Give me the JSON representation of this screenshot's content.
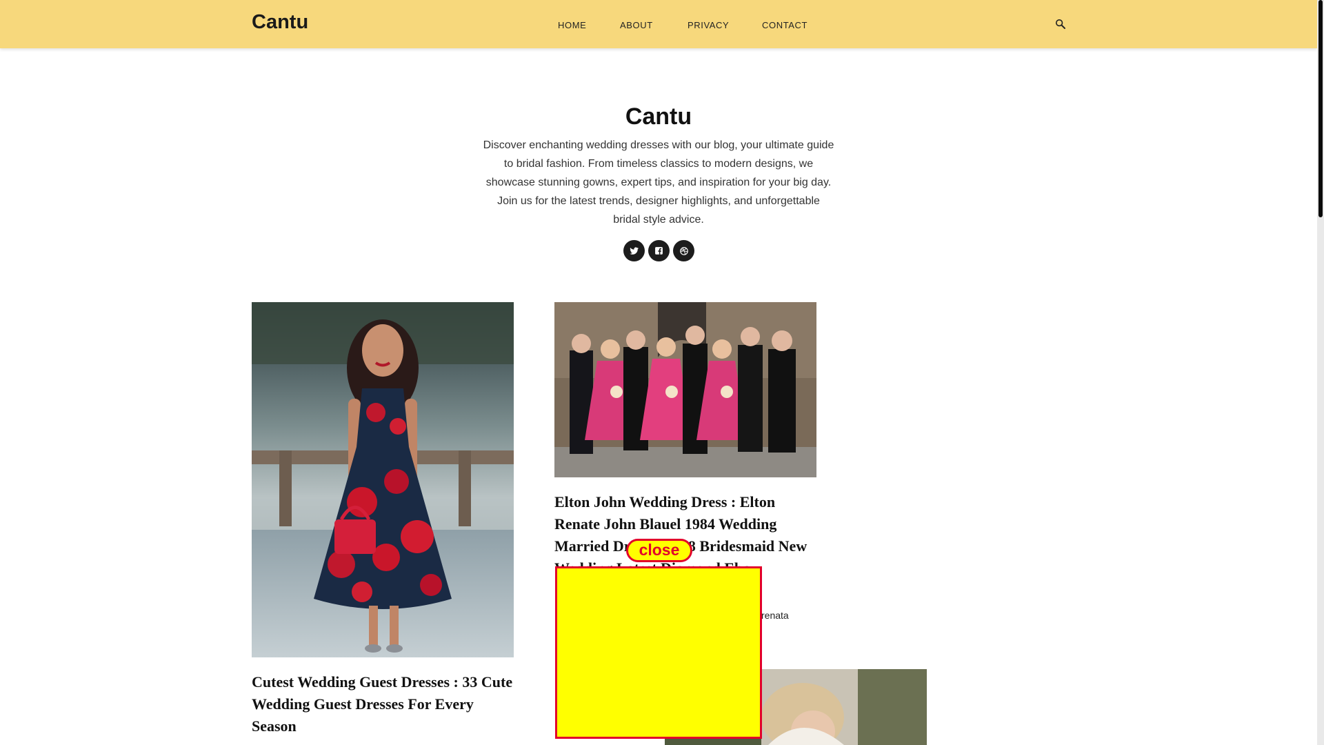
{
  "header": {
    "brand": "Cantu",
    "nav": [
      "HOME",
      "ABOUT",
      "PRIVACY",
      "CONTACT"
    ],
    "search_icon": "search-icon",
    "background_color": "#f7d87c"
  },
  "hero": {
    "title": "Cantu",
    "description": "Discover enchanting wedding dresses with our blog, your ultimate guide to bridal fashion. From timeless classics to modern designs, we showcase stunning gowns, expert tips, and inspiration for your big day. Join us for the latest trends, designer highlights, and unforgettable bridal style advice.",
    "social_icons": [
      "twitter-icon",
      "facebook-icon",
      "dribbble-icon"
    ]
  },
  "posts": [
    {
      "title": "Cutest Wedding Guest Dresses : 33 Cute Wedding Guest Dresses For Every Season",
      "image": "woman-in-floral-dress-photo"
    },
    {
      "title": "Elton John Wedding Dress : Elton Renate John Blauel 1984 Wedding Married Dresses 1988 Bridesmaid New Wedding Latest Diamond Ebay",
      "meta": "renata",
      "image": "wedding-party-group-photo"
    },
    {
      "image": "bride-portrait-photo"
    }
  ],
  "ad": {
    "close_label": "close",
    "background_color": "#ffff00",
    "border_color": "#e2002a"
  }
}
